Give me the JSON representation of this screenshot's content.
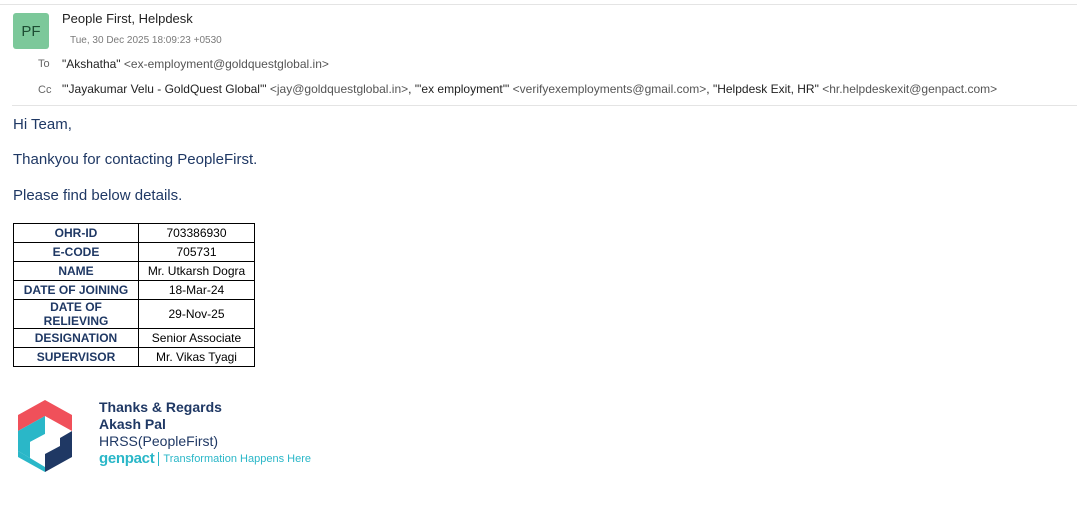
{
  "email": {
    "avatar_initials": "PF",
    "sender": "People First, Helpdesk",
    "date": "Tue, 30 Dec 2025 18:09:23 +0530",
    "to_label": "To",
    "to": [
      {
        "name": "\"Akshatha\"",
        "addr": "<ex-employment@goldquestglobal.in>"
      }
    ],
    "cc_label": "Cc",
    "cc": [
      {
        "name": "\"'Jayakumar Velu - GoldQuest Global'\"",
        "addr": "<jay@goldquestglobal.in>",
        "sep": ","
      },
      {
        "name": "\"'ex employment'\"",
        "addr": "<verifyexemployments@gmail.com>",
        "sep": ","
      },
      {
        "name": "\"Helpdesk Exit, HR\"",
        "addr": "<hr.helpdeskexit@genpact.com>",
        "sep": ""
      }
    ]
  },
  "body": {
    "greeting": "Hi Team,",
    "line1": "Thankyou for contacting PeopleFirst.",
    "line2": "Please find below details."
  },
  "details": [
    {
      "key": "OHR-ID",
      "value": "703386930"
    },
    {
      "key": "E-CODE",
      "value": "705731"
    },
    {
      "key": "NAME",
      "value": "Mr. Utkarsh Dogra"
    },
    {
      "key": "DATE OF JOINING",
      "value": "18-Mar-24"
    },
    {
      "key": "DATE OF RELIEVING",
      "value": "29-Nov-25"
    },
    {
      "key": "DESIGNATION",
      "value": "Senior Associate"
    },
    {
      "key": "SUPERVISOR",
      "value": "Mr. Vikas  Tyagi"
    }
  ],
  "signature": {
    "regards": "Thanks & Regards",
    "name": "Akash Pal",
    "dept": "HRSS(PeopleFirst)",
    "brand": "genpact",
    "tagline": "Transformation Happens Here"
  },
  "colors": {
    "body_text": "#1f3864",
    "avatar_bg": "#7cc89a",
    "brand": "#2ab7c8",
    "logo_red": "#f0505a",
    "logo_navy": "#1f3864",
    "logo_teal": "#2ab7c8"
  }
}
